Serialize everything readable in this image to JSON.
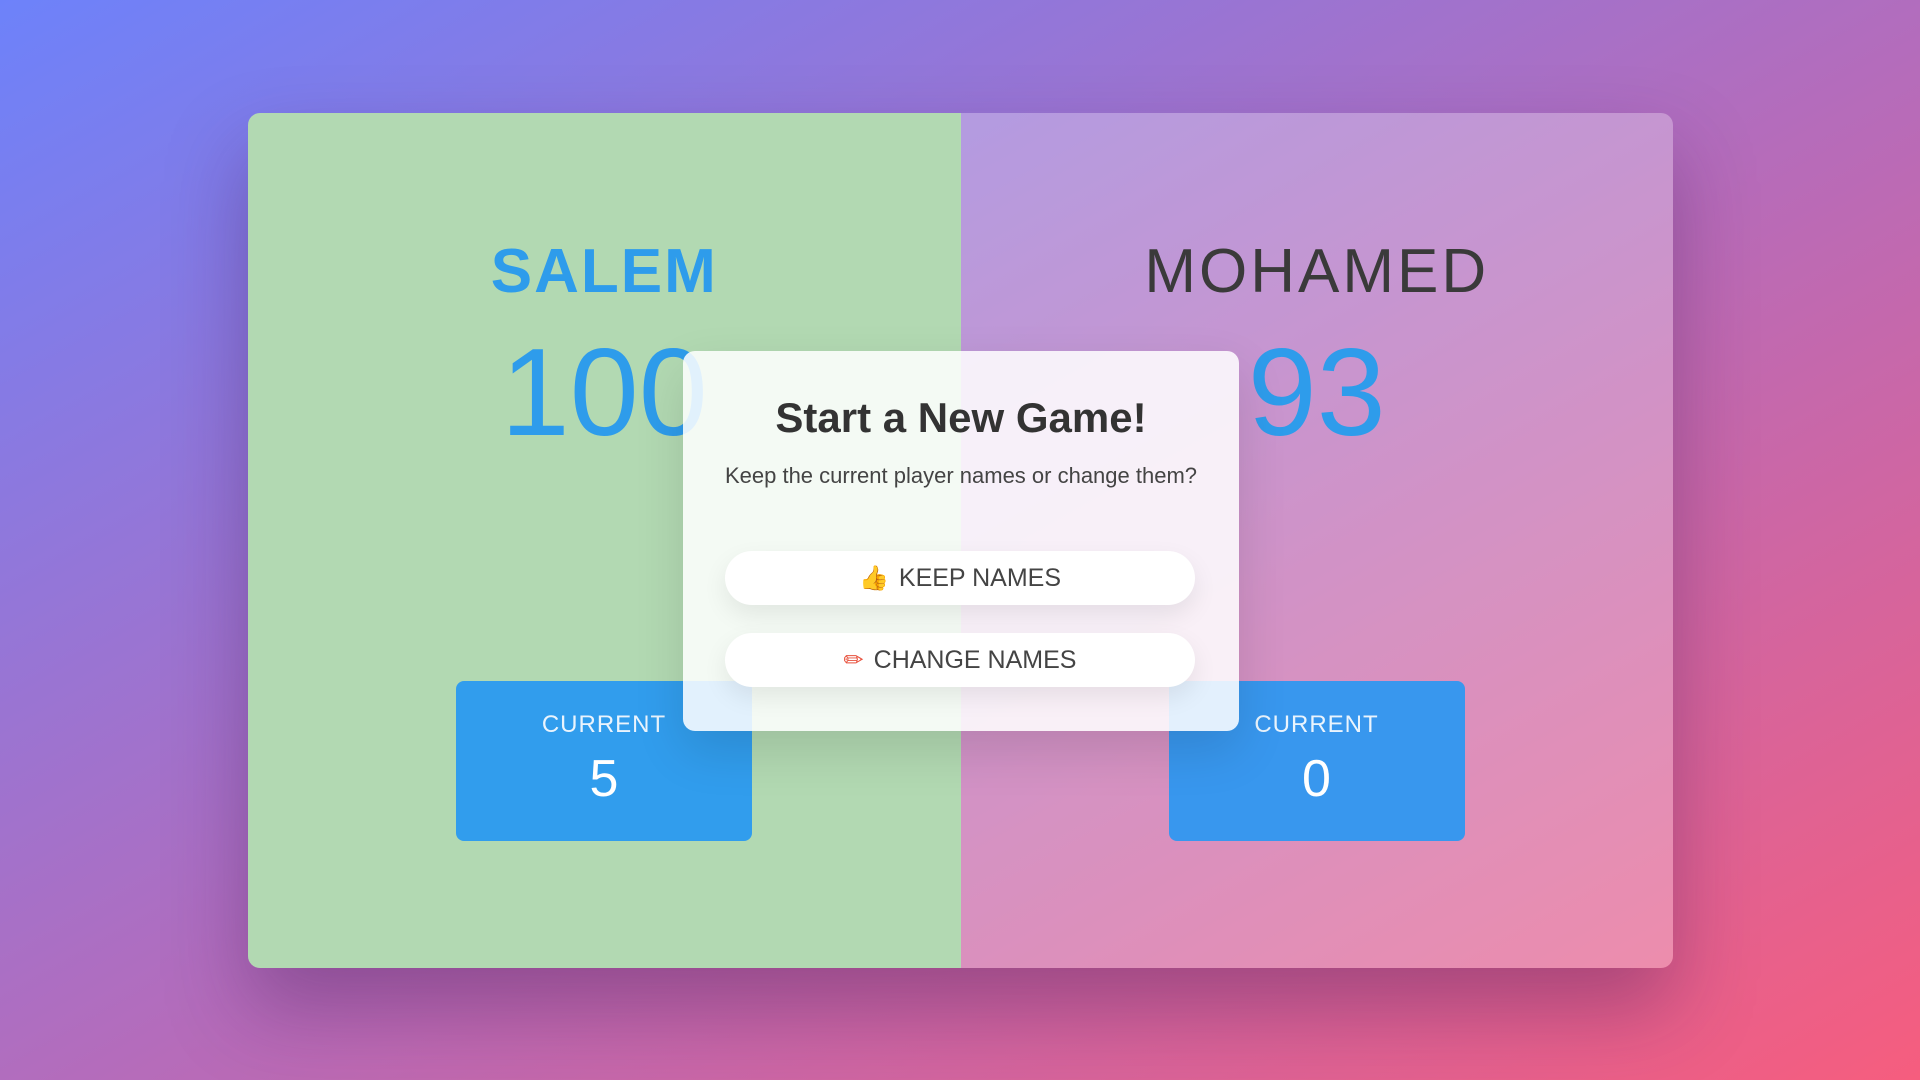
{
  "players": [
    {
      "name": "SALEM",
      "score": "100",
      "current_label": "CURRENT",
      "current": "5",
      "active": true
    },
    {
      "name": "MOHAMED",
      "score": "93",
      "current_label": "CURRENT",
      "current": "0",
      "active": false
    }
  ],
  "modal": {
    "title": "Start a New Game!",
    "text": "Keep the current player names or change them?",
    "keep_button": {
      "icon": "thumbs-up-icon",
      "label": "KEEP NAMES"
    },
    "change_button": {
      "icon": "pencil-icon",
      "label": "CHANGE NAMES"
    }
  },
  "colors": {
    "active_panel": "#b2d9b2",
    "accent_blue": "#2e9ceb",
    "current_box": "#319ded",
    "background_start": "#6d82fa",
    "background_end": "#f65d7e"
  }
}
